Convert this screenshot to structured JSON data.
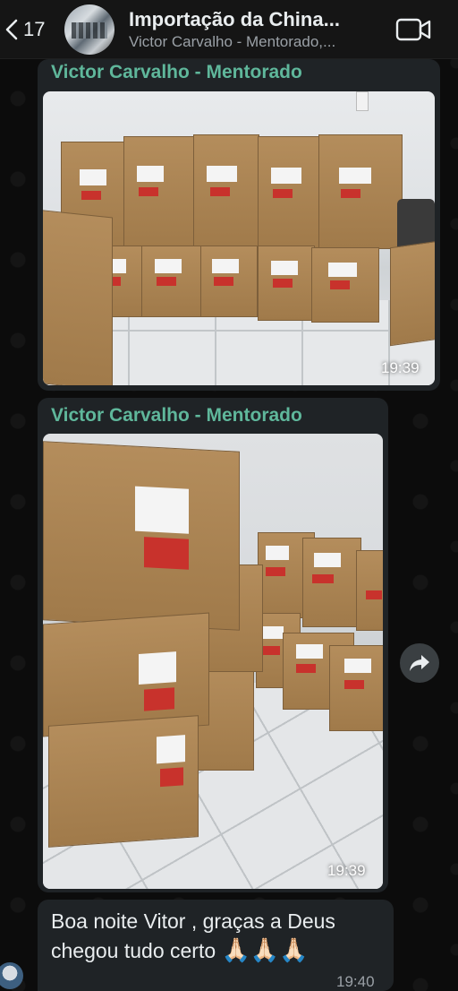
{
  "header": {
    "back_count": "17",
    "title": "Importação da China...",
    "subtitle": "Victor Carvalho - Mentorado,..."
  },
  "messages": [
    {
      "sender": "Victor Carvalho - Mentorado",
      "time": "19:39",
      "photo_alt": "Stacked cardboard boxes labeled Victor Hugo"
    },
    {
      "sender": "Victor Carvalho - Mentorado",
      "time": "19:39",
      "photo_alt": "Tall stack of cardboard boxes labeled Victor Hugo 11/15 and 15/15"
    },
    {
      "text_line1": "Boa noite Vitor , graças a Deus",
      "text_line2": "chegou tudo certo",
      "emoji": "🙏🏻🙏🏻🙏🏻",
      "time": "19:40"
    }
  ],
  "colors": {
    "sender": "#5fb79b",
    "bubble": "#1f2326",
    "header": "#151515"
  },
  "icons": {
    "back": "chevron-left-icon",
    "video": "video-camera-icon",
    "share": "forward-arrow-icon"
  }
}
